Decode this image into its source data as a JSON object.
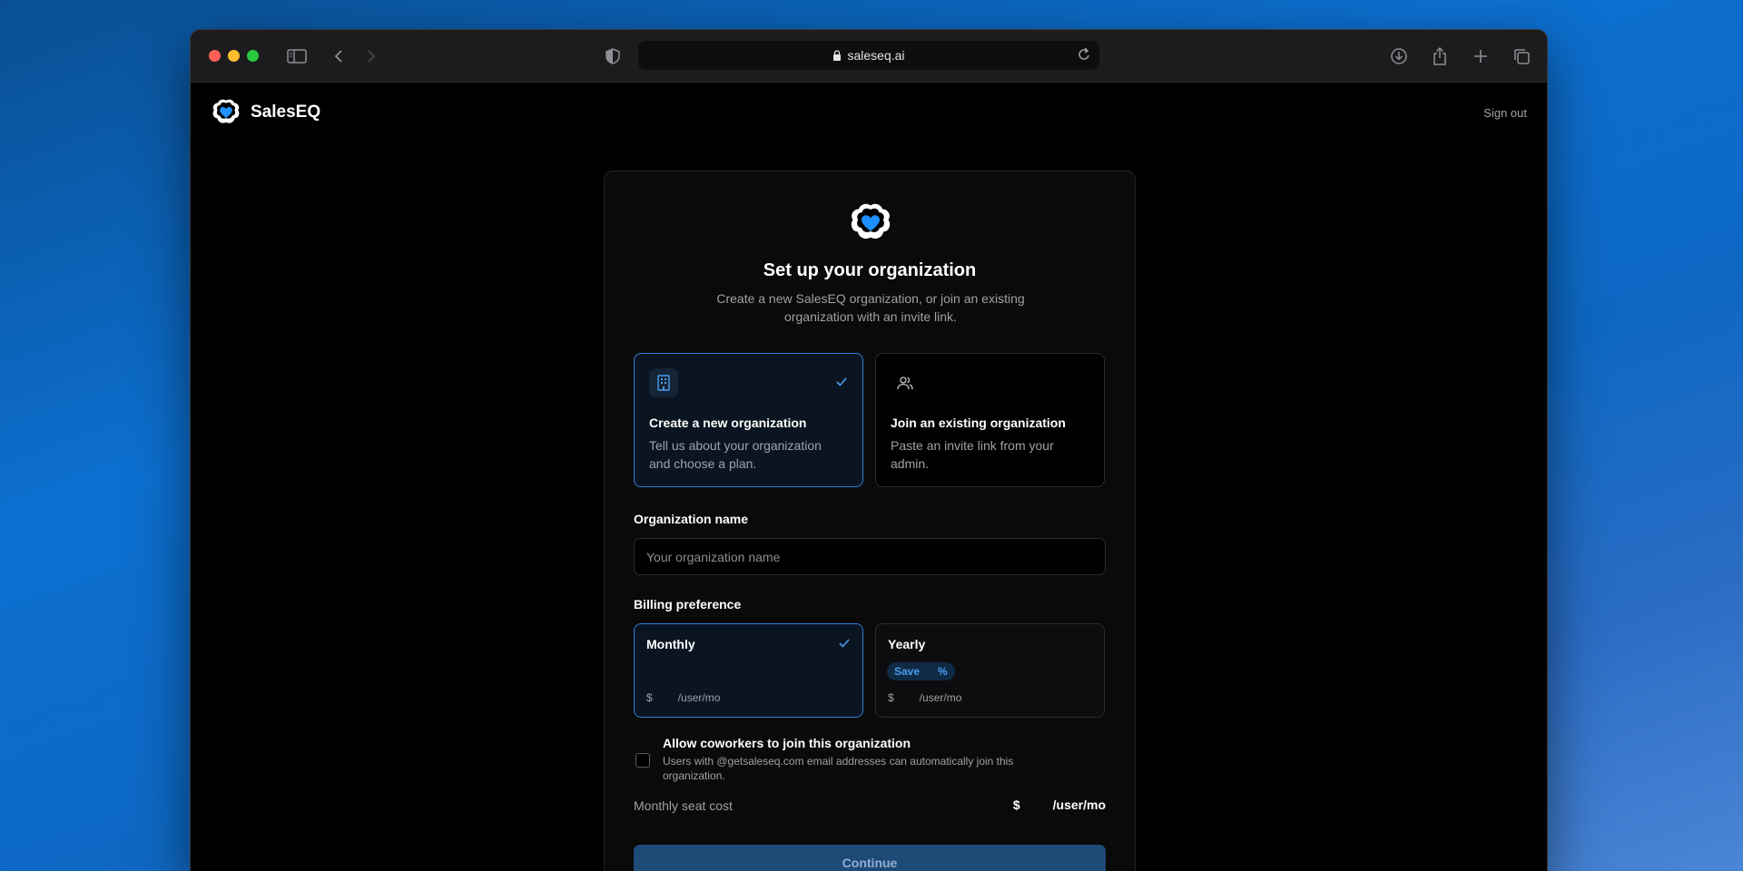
{
  "browser": {
    "url": "saleseq.ai"
  },
  "header": {
    "brand_name": "SalesEQ",
    "sign_out_label": "Sign out"
  },
  "setup": {
    "title": "Set up your organization",
    "subtitle": "Create a new SalesEQ organization, or join an existing organization with an invite link.",
    "options": [
      {
        "title": "Create a new organization",
        "description": "Tell us about your organization and choose a plan.",
        "selected": true
      },
      {
        "title": "Join an existing organization",
        "description": "Paste an invite link from your admin.",
        "selected": false
      }
    ],
    "org_name_label": "Organization name",
    "org_name_placeholder": "Your organization name",
    "org_name_value": "",
    "billing_label": "Billing preference",
    "billing": [
      {
        "title": "Monthly",
        "currency": "$",
        "unit": "/user/mo",
        "selected": true
      },
      {
        "title": "Yearly",
        "badge_save": "Save",
        "badge_percent": "%",
        "currency": "$",
        "unit": "/user/mo",
        "selected": false
      }
    ],
    "allow_coworkers_title": "Allow coworkers to join this organization",
    "allow_coworkers_desc": "Users with @getsaleseq.com email addresses can automatically join this organization.",
    "allow_coworkers_checked": false,
    "seat_cost_label": "Monthly seat cost",
    "seat_cost_currency": "$",
    "seat_cost_unit": "/user/mo",
    "continue_label": "Continue"
  },
  "colors": {
    "accent": "#2f7fd9",
    "heart": "#1e90ff",
    "button": "#1e4a78"
  }
}
